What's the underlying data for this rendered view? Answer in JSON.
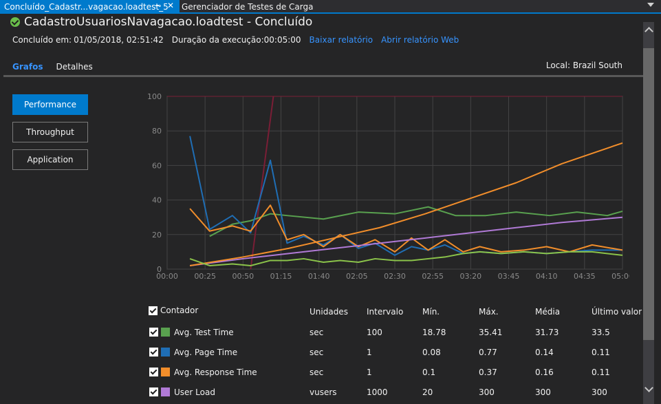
{
  "tabs": {
    "active_label": "Concluído_Cadastr...vagacao.loadtest_5",
    "pin_icon": "pin-icon",
    "close_icon": "close-icon",
    "inactive_label": "Gerenciador de Testes de Carga"
  },
  "header": {
    "title": "CadastroUsuariosNavagacao.loadtest - Concluído",
    "completed_label": "Concluído em:",
    "completed_value": "01/05/2018, 02:51:42",
    "duration_label": "Duração da execução:",
    "duration_value": "00:05:00",
    "download_link": "Baixar relatório",
    "web_link": "Abrir relatório Web"
  },
  "subtabs": {
    "graphs": "Grafos",
    "details": "Detalhes",
    "location": "Local: Brazil South"
  },
  "graph_buttons": {
    "performance": "Performance",
    "throughput": "Throughput",
    "application": "Application"
  },
  "colors": {
    "accent": "#007acc",
    "test_time": "#59a14f",
    "page_time": "#1f6eb5",
    "response_time": "#f28e2b",
    "user_load": "#b07ad6",
    "light_green": "#8bc34a",
    "cursor_line": "#7a1e36"
  },
  "chart_data": {
    "type": "line",
    "ylim": [
      0,
      100
    ],
    "yticks": [
      "0",
      "20",
      "40",
      "60",
      "80",
      "100"
    ],
    "xticks": [
      "00:00",
      "00:25",
      "00:50",
      "01:15",
      "01:40",
      "02:05",
      "02:30",
      "02:55",
      "03:20",
      "03:45",
      "04:10",
      "04:35",
      "05:00"
    ],
    "xlim_seconds": [
      0,
      300
    ],
    "cursor_line_seconds": [
      55,
      70
    ],
    "series": [
      {
        "name": "Avg. Test Time",
        "color": "#59a14f",
        "x": [
          28,
          43,
          55,
          68,
          79,
          103,
          126,
          150,
          172,
          190,
          210,
          230,
          252,
          270,
          290,
          300
        ],
        "y": [
          19,
          26,
          28,
          32,
          31,
          29,
          33,
          32,
          36,
          31,
          31,
          33,
          31,
          33,
          31,
          33.5
        ]
      },
      {
        "name": "Avg. Page Time",
        "color": "#1f6eb5",
        "x": [
          15,
          28,
          43,
          55,
          68,
          79,
          90,
          103,
          114,
          126,
          137,
          150,
          161,
          172,
          183,
          195,
          206,
          220,
          235,
          250,
          265,
          280,
          300
        ],
        "y": [
          77,
          23,
          31,
          21,
          63,
          15,
          19,
          14,
          20,
          12,
          15,
          8,
          13,
          11,
          14,
          9,
          10,
          9,
          10,
          9,
          10,
          11,
          11
        ]
      },
      {
        "name": "Avg. Response Time",
        "color": "#f28e2b",
        "x": [
          15,
          28,
          43,
          55,
          68,
          79,
          90,
          103,
          114,
          126,
          137,
          150,
          161,
          172,
          183,
          195,
          206,
          220,
          235,
          250,
          265,
          280,
          300
        ],
        "y": [
          35,
          22,
          25,
          22,
          37,
          17,
          20,
          13,
          20,
          13,
          17,
          10,
          18,
          11,
          17,
          10,
          13,
          10,
          11,
          13,
          10,
          14,
          11
        ]
      },
      {
        "name": "User Load",
        "color": "#b07ad6",
        "x": [
          15,
          50,
          80,
          110,
          140,
          170,
          200,
          230,
          260,
          300
        ],
        "y": [
          2,
          6,
          9,
          12,
          15,
          18,
          21,
          24,
          27,
          30
        ]
      },
      {
        "name": "",
        "color": "#f28e2b",
        "x": [
          15,
          50,
          80,
          110,
          140,
          170,
          200,
          230,
          260,
          300
        ],
        "y": [
          2,
          7,
          12,
          18,
          24,
          32,
          41,
          50,
          61,
          73
        ]
      },
      {
        "name": "",
        "color": "#8bc34a",
        "x": [
          15,
          28,
          43,
          55,
          68,
          79,
          90,
          103,
          114,
          126,
          137,
          150,
          161,
          172,
          183,
          195,
          206,
          220,
          235,
          250,
          265,
          280,
          300
        ],
        "y": [
          6,
          2,
          3,
          2,
          5,
          5,
          6,
          4,
          5,
          4,
          6,
          5,
          5,
          6,
          7,
          9,
          10,
          9,
          10,
          9,
          10,
          10,
          8
        ]
      }
    ]
  },
  "table": {
    "headers": {
      "counter": "Contador",
      "units": "Unidades",
      "interval": "Intervalo",
      "min": "Mín.",
      "max": "Máx.",
      "avg": "Média",
      "last": "Último valor"
    },
    "rows": [
      {
        "name": "Avg. Test Time",
        "units": "sec",
        "interval": "100",
        "min": "18.78",
        "max": "35.41",
        "avg": "31.73",
        "last": "33.5"
      },
      {
        "name": "Avg. Page Time",
        "units": "sec",
        "interval": "1",
        "min": "0.08",
        "max": "0.77",
        "avg": "0.14",
        "last": "0.11"
      },
      {
        "name": "Avg. Response Time",
        "units": "sec",
        "interval": "1",
        "min": "0.1",
        "max": "0.37",
        "avg": "0.16",
        "last": "0.11"
      },
      {
        "name": "User Load",
        "units": "vusers",
        "interval": "1000",
        "min": "20",
        "max": "300",
        "avg": "300",
        "last": "300"
      }
    ]
  }
}
